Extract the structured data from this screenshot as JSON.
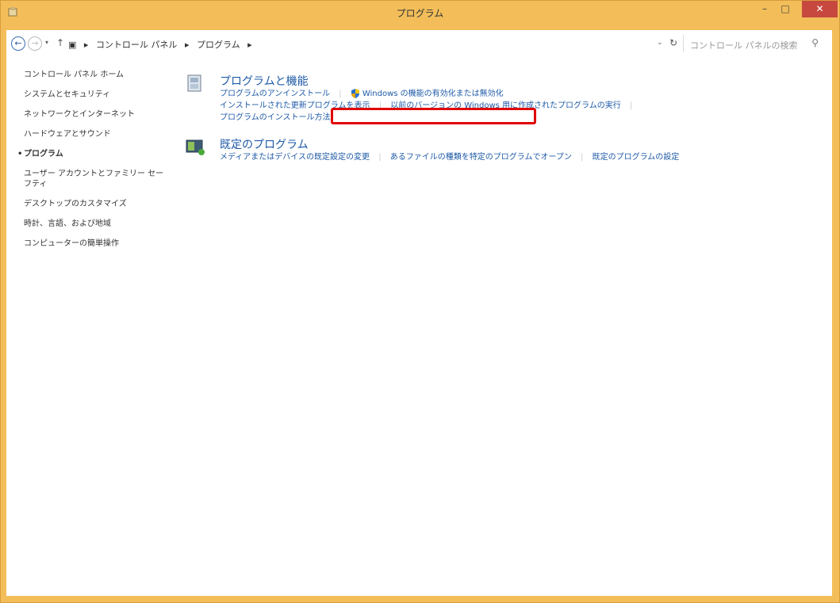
{
  "window": {
    "title": "プログラム"
  },
  "titlebar": {
    "minimize": "–",
    "maximize": "□",
    "close": "✕"
  },
  "nav": {
    "back": "←",
    "forward": "→",
    "breadcrumbs": [
      "コントロール パネル",
      "プログラム"
    ],
    "search_placeholder": "コントロール パネルの検索"
  },
  "sidebar": {
    "items": [
      "コントロール パネル ホーム",
      "システムとセキュリティ",
      "ネットワークとインターネット",
      "ハードウェアとサウンド",
      "プログラム",
      "ユーザー アカウントとファミリー セーフティ",
      "デスクトップのカスタマイズ",
      "時計、言語、および地域",
      "コンピューターの簡単操作"
    ],
    "current": "プログラム"
  },
  "sections": {
    "programs": {
      "title": "プログラムと機能",
      "links": [
        "プログラムのアンインストール",
        "Windows の機能の有効化または無効化",
        "インストールされた更新プログラムを表示",
        "以前のバージョンの Windows 用に作成されたプログラムの実行",
        "プログラムのインストール方法"
      ]
    },
    "defaults": {
      "title": "既定のプログラム",
      "links": [
        "メディアまたはデバイスの既定設定の変更",
        "あるファイルの種類を特定のプログラムでオープン",
        "既定のプログラムの設定"
      ]
    }
  },
  "colors": {
    "titlebar": "#f3be59",
    "link": "#1e5aa7",
    "highlight": "#e00000",
    "close": "#c7483e"
  }
}
